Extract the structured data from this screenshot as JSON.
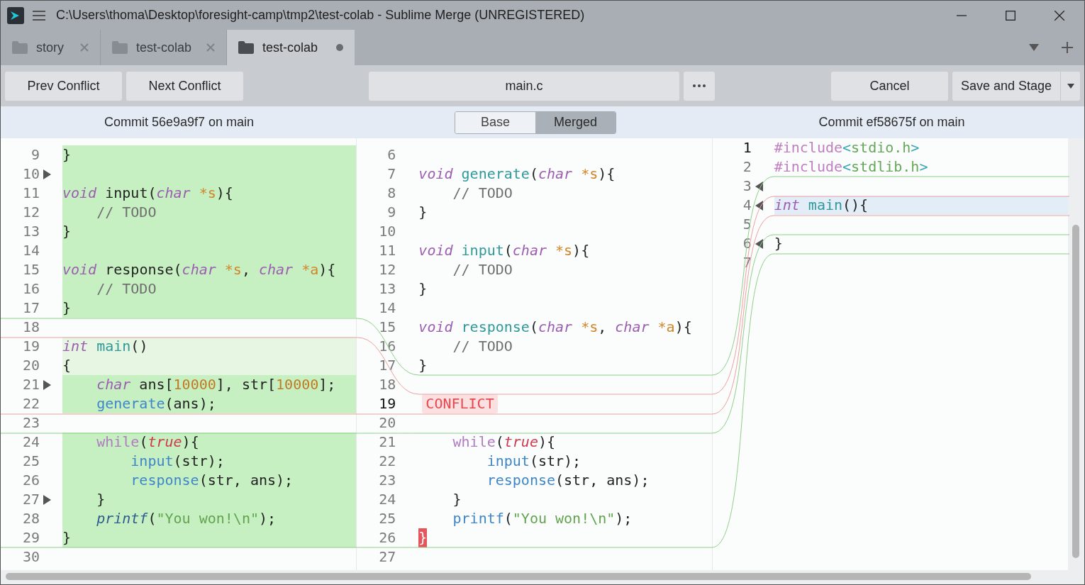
{
  "window": {
    "title": "C:\\Users\\thoma\\Desktop\\foresight-camp\\tmp2\\test-colab - Sublime Merge (UNREGISTERED)"
  },
  "tabs": [
    {
      "label": "story",
      "selected": false,
      "modified": false
    },
    {
      "label": "test-colab",
      "selected": false,
      "modified": false
    },
    {
      "label": "test-colab",
      "selected": true,
      "modified": true
    }
  ],
  "toolbar": {
    "prev": "Prev Conflict",
    "next": "Next Conflict",
    "file": "main.c",
    "cancel": "Cancel",
    "save": "Save and Stage"
  },
  "header": {
    "left": "Commit 56e9a9f7 on main",
    "right": "Commit ef58675f on main",
    "views": [
      {
        "label": "Base",
        "selected": false
      },
      {
        "label": "Merged",
        "selected": true
      }
    ]
  },
  "panes": [
    {
      "kind": "ours",
      "rows": [
        {
          "num": "9",
          "kind": "added",
          "current": false,
          "marker": false,
          "tokens": [
            {
              "text": "}",
              "kind": "plain"
            }
          ]
        },
        {
          "num": "10",
          "kind": "added",
          "current": false,
          "marker": true,
          "tokens": []
        },
        {
          "num": "11",
          "kind": "added",
          "current": false,
          "marker": false,
          "tokens": [
            {
              "text": "void",
              "kind": "kw"
            },
            {
              "text": " input(",
              "kind": "plain"
            },
            {
              "text": "char",
              "kind": "kw"
            },
            {
              "text": " *s",
              "kind": "param"
            },
            {
              "text": "){",
              "kind": "plain"
            }
          ]
        },
        {
          "num": "12",
          "kind": "added",
          "current": false,
          "marker": false,
          "tokens": [
            {
              "text": "    // TODO",
              "kind": "cmt"
            }
          ]
        },
        {
          "num": "13",
          "kind": "added",
          "current": false,
          "marker": false,
          "tokens": [
            {
              "text": "}",
              "kind": "plain"
            }
          ]
        },
        {
          "num": "14",
          "kind": "added",
          "current": false,
          "marker": false,
          "tokens": []
        },
        {
          "num": "15",
          "kind": "added",
          "current": false,
          "marker": false,
          "tokens": [
            {
              "text": "void",
              "kind": "kw"
            },
            {
              "text": " response(",
              "kind": "plain"
            },
            {
              "text": "char",
              "kind": "kw"
            },
            {
              "text": " *s",
              "kind": "param"
            },
            {
              "text": ", ",
              "kind": "plain"
            },
            {
              "text": "char",
              "kind": "kw"
            },
            {
              "text": " *a",
              "kind": "param"
            },
            {
              "text": "){",
              "kind": "plain"
            }
          ]
        },
        {
          "num": "16",
          "kind": "added",
          "current": false,
          "marker": false,
          "tokens": [
            {
              "text": "    // TODO",
              "kind": "cmt"
            }
          ]
        },
        {
          "num": "17",
          "kind": "added",
          "current": false,
          "marker": false,
          "tokens": [
            {
              "text": "}",
              "kind": "plain"
            }
          ]
        },
        {
          "num": "18",
          "kind": "normal",
          "current": false,
          "marker": false,
          "tokens": []
        },
        {
          "num": "19",
          "kind": "context",
          "current": false,
          "marker": false,
          "tokens": [
            {
              "text": "int",
              "kind": "kw"
            },
            {
              "text": " main",
              "kind": "fn"
            },
            {
              "text": "()",
              "kind": "plain"
            }
          ]
        },
        {
          "num": "20",
          "kind": "context",
          "current": false,
          "marker": false,
          "tokens": [
            {
              "text": "{",
              "kind": "plain"
            }
          ]
        },
        {
          "num": "21",
          "kind": "added",
          "current": false,
          "marker": true,
          "tokens": [
            {
              "text": "    char",
              "kind": "kw"
            },
            {
              "text": " ans[",
              "kind": "plain"
            },
            {
              "text": "10000",
              "kind": "num"
            },
            {
              "text": "], str[",
              "kind": "plain"
            },
            {
              "text": "10000",
              "kind": "num"
            },
            {
              "text": "];",
              "kind": "plain"
            }
          ]
        },
        {
          "num": "22",
          "kind": "added",
          "current": false,
          "marker": false,
          "tokens": [
            {
              "text": "    generate",
              "kind": "call"
            },
            {
              "text": "(ans);",
              "kind": "plain"
            }
          ]
        },
        {
          "num": "23",
          "kind": "normal",
          "current": false,
          "marker": false,
          "tokens": []
        },
        {
          "num": "24",
          "kind": "added",
          "current": false,
          "marker": false,
          "tokens": [
            {
              "text": "    while",
              "kind": "ctrl"
            },
            {
              "text": "(",
              "kind": "plain"
            },
            {
              "text": "true",
              "kind": "bool"
            },
            {
              "text": "){",
              "kind": "plain"
            }
          ]
        },
        {
          "num": "25",
          "kind": "added",
          "current": false,
          "marker": false,
          "tokens": [
            {
              "text": "        input",
              "kind": "call"
            },
            {
              "text": "(str);",
              "kind": "plain"
            }
          ]
        },
        {
          "num": "26",
          "kind": "added",
          "current": false,
          "marker": false,
          "tokens": [
            {
              "text": "        response",
              "kind": "call"
            },
            {
              "text": "(str, ans);",
              "kind": "plain"
            }
          ]
        },
        {
          "num": "27",
          "kind": "added",
          "current": false,
          "marker": true,
          "tokens": [
            {
              "text": "    }",
              "kind": "plain"
            }
          ]
        },
        {
          "num": "28",
          "kind": "added",
          "current": false,
          "marker": false,
          "tokens": [
            {
              "text": "    printf",
              "kind": "builtin"
            },
            {
              "text": "(",
              "kind": "plain"
            },
            {
              "text": "\"You won!\\n\"",
              "kind": "str"
            },
            {
              "text": ");",
              "kind": "plain"
            }
          ]
        },
        {
          "num": "29",
          "kind": "added",
          "current": false,
          "marker": false,
          "tokens": [
            {
              "text": "}",
              "kind": "plain"
            }
          ]
        },
        {
          "num": "30",
          "kind": "normal",
          "current": false,
          "marker": false,
          "tokens": []
        }
      ]
    },
    {
      "kind": "merged",
      "rows": [
        {
          "num": "6",
          "kind": "normal",
          "current": false,
          "tokens": []
        },
        {
          "num": "7",
          "kind": "normal",
          "current": false,
          "tokens": [
            {
              "text": "void",
              "kind": "kw"
            },
            {
              "text": " generate",
              "kind": "fn"
            },
            {
              "text": "(",
              "kind": "plain"
            },
            {
              "text": "char",
              "kind": "kw"
            },
            {
              "text": " *s",
              "kind": "param"
            },
            {
              "text": "){",
              "kind": "plain"
            }
          ]
        },
        {
          "num": "8",
          "kind": "normal",
          "current": false,
          "tokens": [
            {
              "text": "    // TODO",
              "kind": "cmt"
            }
          ]
        },
        {
          "num": "9",
          "kind": "normal",
          "current": false,
          "tokens": [
            {
              "text": "}",
              "kind": "plain"
            }
          ]
        },
        {
          "num": "10",
          "kind": "normal",
          "current": false,
          "tokens": []
        },
        {
          "num": "11",
          "kind": "normal",
          "current": false,
          "tokens": [
            {
              "text": "void",
              "kind": "kw"
            },
            {
              "text": " input",
              "kind": "fn"
            },
            {
              "text": "(",
              "kind": "plain"
            },
            {
              "text": "char",
              "kind": "kw"
            },
            {
              "text": " *s",
              "kind": "param"
            },
            {
              "text": "){",
              "kind": "plain"
            }
          ]
        },
        {
          "num": "12",
          "kind": "normal",
          "current": false,
          "tokens": [
            {
              "text": "    // TODO",
              "kind": "cmt"
            }
          ]
        },
        {
          "num": "13",
          "kind": "normal",
          "current": false,
          "tokens": [
            {
              "text": "}",
              "kind": "plain"
            }
          ]
        },
        {
          "num": "14",
          "kind": "normal",
          "current": false,
          "tokens": []
        },
        {
          "num": "15",
          "kind": "normal",
          "current": false,
          "tokens": [
            {
              "text": "void",
              "kind": "kw"
            },
            {
              "text": " response",
              "kind": "fn"
            },
            {
              "text": "(",
              "kind": "plain"
            },
            {
              "text": "char",
              "kind": "kw"
            },
            {
              "text": " *s",
              "kind": "param"
            },
            {
              "text": ", ",
              "kind": "plain"
            },
            {
              "text": "char",
              "kind": "kw"
            },
            {
              "text": " *a",
              "kind": "param"
            },
            {
              "text": "){",
              "kind": "plain"
            }
          ]
        },
        {
          "num": "16",
          "kind": "normal",
          "current": false,
          "tokens": [
            {
              "text": "    // TODO",
              "kind": "cmt"
            }
          ]
        },
        {
          "num": "17",
          "kind": "normal",
          "current": false,
          "tokens": [
            {
              "text": "}",
              "kind": "plain"
            }
          ]
        },
        {
          "num": "18",
          "kind": "normal",
          "current": false,
          "tokens": []
        },
        {
          "num": "19",
          "kind": "normal",
          "current": true,
          "tokens": [
            {
              "text": "CONFLICT",
              "kind": "conflict"
            }
          ]
        },
        {
          "num": "20",
          "kind": "normal",
          "current": false,
          "tokens": []
        },
        {
          "num": "21",
          "kind": "normal",
          "current": false,
          "tokens": [
            {
              "text": "    while",
              "kind": "ctrl"
            },
            {
              "text": "(",
              "kind": "plain"
            },
            {
              "text": "true",
              "kind": "bool"
            },
            {
              "text": "){",
              "kind": "plain"
            }
          ]
        },
        {
          "num": "22",
          "kind": "normal",
          "current": false,
          "tokens": [
            {
              "text": "        input",
              "kind": "call"
            },
            {
              "text": "(str);",
              "kind": "plain"
            }
          ]
        },
        {
          "num": "23",
          "kind": "normal",
          "current": false,
          "tokens": [
            {
              "text": "        response",
              "kind": "call"
            },
            {
              "text": "(str, ans);",
              "kind": "plain"
            }
          ]
        },
        {
          "num": "24",
          "kind": "normal",
          "current": false,
          "tokens": [
            {
              "text": "    }",
              "kind": "plain"
            }
          ]
        },
        {
          "num": "25",
          "kind": "normal",
          "current": false,
          "tokens": [
            {
              "text": "    printf",
              "kind": "call"
            },
            {
              "text": "(",
              "kind": "plain"
            },
            {
              "text": "\"You won!\\n\"",
              "kind": "str"
            },
            {
              "text": ");",
              "kind": "plain"
            }
          ]
        },
        {
          "num": "26",
          "kind": "normal",
          "current": false,
          "tokens": [
            {
              "text": "}",
              "kind": "conflict-brace"
            }
          ]
        },
        {
          "num": "27",
          "kind": "normal",
          "current": false,
          "tokens": []
        }
      ]
    },
    {
      "kind": "theirs",
      "rows": [
        {
          "num": "1",
          "kind": "normal",
          "current": true,
          "marker": false,
          "tokens": [
            {
              "text": "#include",
              "kind": "preproc"
            },
            {
              "text": "<",
              "kind": "angle"
            },
            {
              "text": "stdio.h",
              "kind": "header"
            },
            {
              "text": ">",
              "kind": "angle"
            }
          ]
        },
        {
          "num": "2",
          "kind": "normal",
          "current": false,
          "marker": false,
          "tokens": [
            {
              "text": "#include",
              "kind": "preproc"
            },
            {
              "text": "<",
              "kind": "angle"
            },
            {
              "text": "stdlib.h",
              "kind": "header"
            },
            {
              "text": ">",
              "kind": "angle"
            }
          ]
        },
        {
          "num": "3",
          "kind": "normal",
          "current": false,
          "marker": true,
          "tokens": []
        },
        {
          "num": "4",
          "kind": "selection",
          "current": false,
          "marker": true,
          "tokens": [
            {
              "text": "int",
              "kind": "kw"
            },
            {
              "text": " main",
              "kind": "fn"
            },
            {
              "text": "(){",
              "kind": "plain"
            }
          ]
        },
        {
          "num": "5",
          "kind": "normal",
          "current": false,
          "marker": false,
          "tokens": []
        },
        {
          "num": "6",
          "kind": "normal",
          "current": false,
          "marker": true,
          "tokens": [
            {
              "text": "}",
              "kind": "plain"
            }
          ]
        },
        {
          "num": "7",
          "kind": "normal",
          "current": false,
          "marker": false,
          "tokens": []
        }
      ]
    }
  ]
}
